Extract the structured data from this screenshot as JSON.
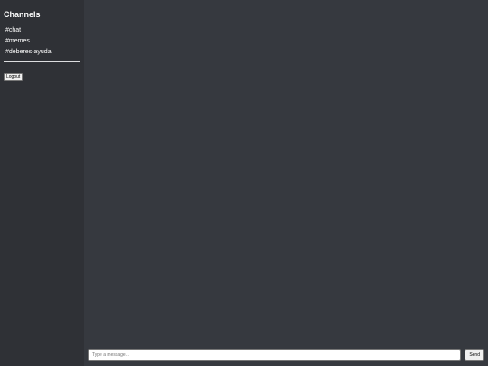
{
  "sidebar": {
    "title": "Channels",
    "channels": [
      {
        "label": "#chat"
      },
      {
        "label": "#memes"
      },
      {
        "label": "#deberes-ayuda"
      }
    ],
    "logout_label": "Logout"
  },
  "composer": {
    "placeholder": "Type a message...",
    "value": "",
    "send_label": "Send"
  },
  "colors": {
    "sidebar_bg": "#2f3136",
    "main_bg": "#36393f",
    "text": "#ffffff"
  }
}
